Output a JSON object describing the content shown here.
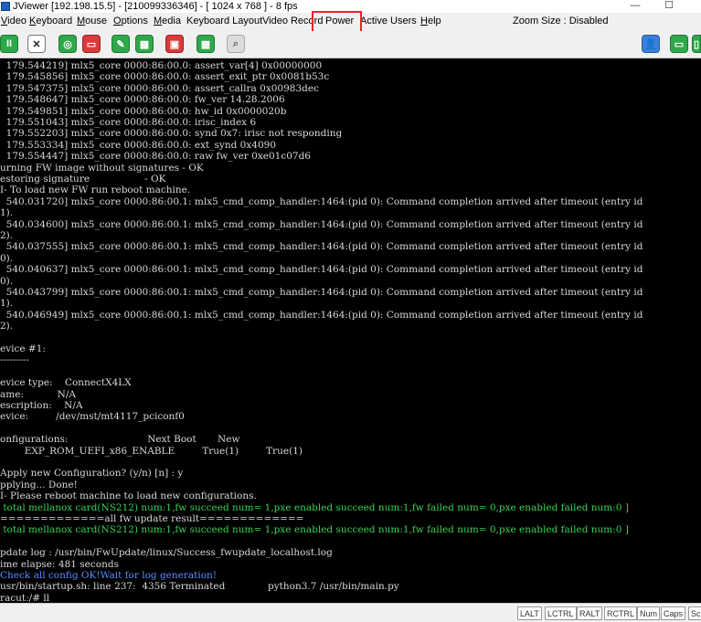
{
  "window": {
    "title": "JViewer [192.198.15.5] - [210099336346] - [ 1024 x 768 ] - 8 fps",
    "minimize_glyph": "—",
    "maximize_glyph": "☐"
  },
  "menu": {
    "items": [
      {
        "ul": "V",
        "rest": "ideo"
      },
      {
        "ul": "K",
        "rest": "eyboard"
      },
      {
        "ul": "M",
        "rest": "ouse"
      },
      {
        "ul": "O",
        "rest": "ptions"
      },
      {
        "ul": "M",
        "rest": "edia"
      },
      {
        "ul": "",
        "rest": "Keyboard Layout"
      },
      {
        "ul": "",
        "rest": "Video Record"
      },
      {
        "ul": "",
        "rest": "Power"
      },
      {
        "ul": "",
        "rest": "Active Users"
      },
      {
        "ul": "H",
        "rest": "elp"
      }
    ],
    "zoom_size": "Zoom Size : Disabled",
    "highlighted": "Power"
  },
  "toolbar": {
    "buttons": [
      {
        "icon": "pause-icon",
        "glyph": "II"
      },
      {
        "icon": "mouse-sync-icon",
        "glyph": "✕"
      },
      {
        "icon": "cd-media-icon",
        "glyph": "◎"
      },
      {
        "icon": "hard-disk-icon",
        "glyph": "▭"
      },
      {
        "icon": "keyboard-lang-icon",
        "glyph": "✎"
      },
      {
        "icon": "keyboard-icon",
        "glyph": "▦"
      },
      {
        "icon": "record-icon",
        "glyph": "▣"
      },
      {
        "icon": "power-icon",
        "glyph": "▦"
      },
      {
        "icon": "zoom-icon",
        "glyph": "⌕"
      },
      {
        "icon": "active-users-icon",
        "glyph": "👤"
      },
      {
        "icon": "monitor-icon",
        "glyph": "▭"
      },
      {
        "icon": "exit-icon",
        "glyph": "▯"
      }
    ]
  },
  "terminal": {
    "lines": [
      {
        "text": "  179.544219] mlx5_core 0000:86:00.0: assert_var[4] 0x00000000",
        "style": ""
      },
      {
        "text": "  179.545856] mlx5_core 0000:86:00.0: assert_exit_ptr 0x0081b53c",
        "style": ""
      },
      {
        "text": "  179.547375] mlx5_core 0000:86:00.0: assert_callra 0x00983dec",
        "style": ""
      },
      {
        "text": "  179.548647] mlx5_core 0000:86:00.0: fw_ver 14.28.2006",
        "style": ""
      },
      {
        "text": "  179.549851] mlx5_core 0000:86:00.0: hw_id 0x0000020b",
        "style": ""
      },
      {
        "text": "  179.551043] mlx5_core 0000:86:00.0: irisc_index 6",
        "style": ""
      },
      {
        "text": "  179.552203] mlx5_core 0000:86:00.0: synd 0x7: irisc not responding",
        "style": ""
      },
      {
        "text": "  179.553334] mlx5_core 0000:86:00.0: ext_synd 0x4090",
        "style": ""
      },
      {
        "text": "  179.554447] mlx5_core 0000:86:00.0: raw fw_ver 0xe01c07d6",
        "style": ""
      },
      {
        "text": "urning FW image without signatures - OK",
        "style": ""
      },
      {
        "text": "estoring signature                  - OK",
        "style": ""
      },
      {
        "text": "I- To load new FW run reboot machine.",
        "style": ""
      },
      {
        "text": "  540.031720] mlx5_core 0000:86:00.1: mlx5_cmd_comp_handler:1464:(pid 0): Command completion arrived after timeout (entry id",
        "style": ""
      },
      {
        "text": "1).",
        "style": ""
      },
      {
        "text": "  540.034600] mlx5_core 0000:86:00.1: mlx5_cmd_comp_handler:1464:(pid 0): Command completion arrived after timeout (entry id",
        "style": ""
      },
      {
        "text": "2).",
        "style": ""
      },
      {
        "text": "  540.037555] mlx5_core 0000:86:00.1: mlx5_cmd_comp_handler:1464:(pid 0): Command completion arrived after timeout (entry id",
        "style": ""
      },
      {
        "text": "0).",
        "style": ""
      },
      {
        "text": "  540.040637] mlx5_core 0000:86:00.1: mlx5_cmd_comp_handler:1464:(pid 0): Command completion arrived after timeout (entry id",
        "style": ""
      },
      {
        "text": "0).",
        "style": ""
      },
      {
        "text": "  540.043799] mlx5_core 0000:86:00.1: mlx5_cmd_comp_handler:1464:(pid 0): Command completion arrived after timeout (entry id",
        "style": ""
      },
      {
        "text": "1).",
        "style": ""
      },
      {
        "text": "  540.046949] mlx5_core 0000:86:00.1: mlx5_cmd_comp_handler:1464:(pid 0): Command completion arrived after timeout (entry id",
        "style": ""
      },
      {
        "text": "2).",
        "style": ""
      },
      {
        "text": "",
        "style": ""
      },
      {
        "text": "evice #1:",
        "style": ""
      },
      {
        "text": "---------",
        "style": ""
      },
      {
        "text": "",
        "style": ""
      },
      {
        "text": "evice type:    ConnectX4LX",
        "style": ""
      },
      {
        "text": "ame:           N/A",
        "style": ""
      },
      {
        "text": "escription:    N/A",
        "style": ""
      },
      {
        "text": "evice:         /dev/mst/mt4117_pciconf0",
        "style": ""
      },
      {
        "text": "",
        "style": ""
      },
      {
        "text": "onfigurations:                          Next Boot       New",
        "style": ""
      },
      {
        "text": "        EXP_ROM_UEFI_x86_ENABLE         True(1)         True(1)",
        "style": ""
      },
      {
        "text": "",
        "style": ""
      },
      {
        "text": "Apply new Configuration? (y/n) [n] : y",
        "style": ""
      },
      {
        "text": "pplying... Done!",
        "style": ""
      },
      {
        "text": "I- Please reboot machine to load new configurations.",
        "style": ""
      },
      {
        "text": " total mellanox card(NS212) num:1,fw succeed num= 1,pxe enabled succeed num:1,fw failed num= 0,pxe enabled failed num:0 ]",
        "style": "green"
      },
      {
        "text": "=============all fw update result=============",
        "style": "sep"
      },
      {
        "text": " total mellanox card(NS212) num:1,fw succeed num= 1,pxe enabled succeed num:1,fw failed num= 0,pxe enabled failed num:0 ]",
        "style": "green"
      },
      {
        "text": "",
        "style": ""
      },
      {
        "text": "pdate log : /usr/bin/FwUpdate/linux/Success_fwupdate_localhost.log",
        "style": ""
      },
      {
        "text": "ime elapse: 481 seconds",
        "style": ""
      },
      {
        "text": "Check all config OK!Wait for log generation!",
        "style": "blue"
      },
      {
        "text": "usr/bin/startup.sh: line 237:  4356 Terminated              python3.7 /usr/bin/main.py",
        "style": ""
      },
      {
        "text": "racut:/# ll",
        "style": ""
      }
    ]
  },
  "status": {
    "keys": [
      "LALT",
      "LCTRL",
      "RALT",
      "RCTRL",
      "Num",
      "Caps",
      "Sc"
    ]
  }
}
